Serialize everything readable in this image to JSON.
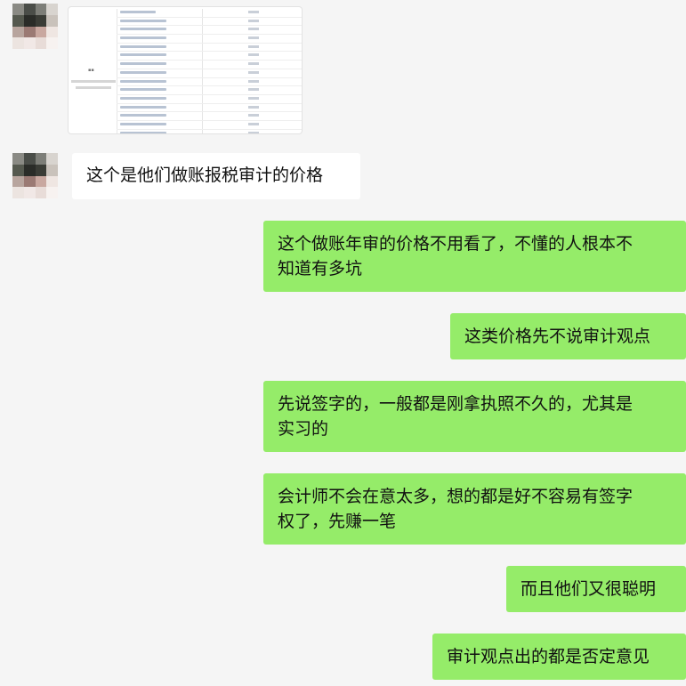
{
  "messages": [
    {
      "side": "left",
      "type": "image"
    },
    {
      "side": "left",
      "type": "text",
      "text": "这个是他们做账报税审计的价格"
    },
    {
      "side": "right",
      "type": "text",
      "lines": [
        "这个做账年审的价格不用看了，不懂的人根本不",
        "知道有多坑"
      ]
    },
    {
      "side": "right",
      "type": "text",
      "text": "这类价格先不说审计观点"
    },
    {
      "side": "right",
      "type": "text",
      "lines": [
        "先说签字的，一般都是刚拿执照不久的，尤其是",
        "实习的"
      ]
    },
    {
      "side": "right",
      "type": "text",
      "lines": [
        "会计师不会在意太多，想的都是好不容易有签字",
        "权了，先赚一笔"
      ]
    },
    {
      "side": "right",
      "type": "text",
      "text": "而且他们又很聪明"
    },
    {
      "side": "right",
      "type": "text",
      "text": "审计观点出的都是否定意见"
    }
  ],
  "colors": {
    "chat_background": "#f5f5f5",
    "outgoing_bubble": "#95ec69",
    "incoming_bubble": "#ffffff"
  }
}
